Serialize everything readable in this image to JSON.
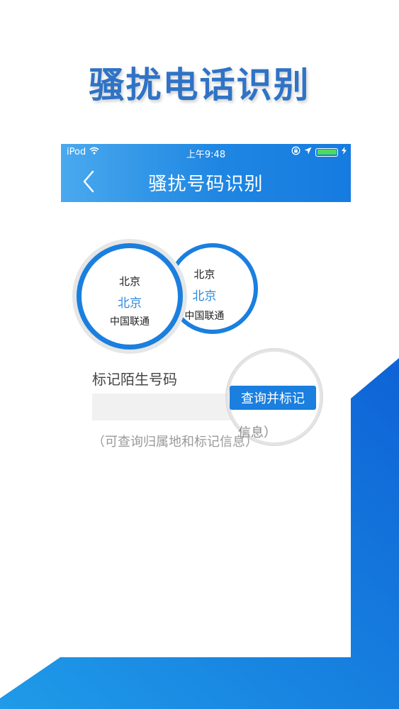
{
  "promo": {
    "title": "骚扰电话识别"
  },
  "statusbar": {
    "carrier": "iPod",
    "time": "上午9:48"
  },
  "navbar": {
    "title": "骚扰号码识别"
  },
  "circles": [
    {
      "line1": "北京",
      "line2": "北京",
      "line3": "中国联通"
    },
    {
      "line1": "北京",
      "line2": "北京",
      "line3": "中国联通"
    }
  ],
  "form": {
    "label": "标记陌生号码",
    "input_value": "",
    "button_label": "查询并标记",
    "hint": "（可查询归属地和标记信息）",
    "zoom_hint": "信息）"
  },
  "colors": {
    "accent": "#1a7fdf",
    "title": "#2f73c5",
    "battery": "#4cd964"
  }
}
